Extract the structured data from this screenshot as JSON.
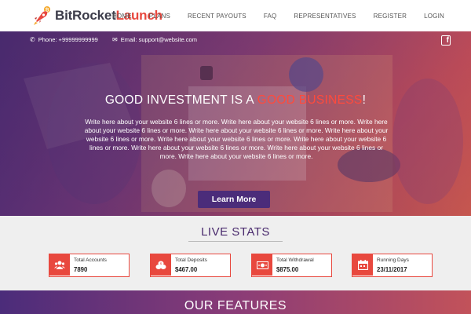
{
  "brand": {
    "name_part1": "BitRocket",
    "name_part2": "Launch",
    "accent": "#e8483e",
    "primary": "#4b2c7a"
  },
  "nav": {
    "items": [
      {
        "label": "HOME"
      },
      {
        "label": "PLANS"
      },
      {
        "label": "RECENT PAYOUTS"
      },
      {
        "label": "FAQ"
      },
      {
        "label": "REPRESENTATIVES"
      },
      {
        "label": "REGISTER"
      },
      {
        "label": "LOGIN"
      }
    ]
  },
  "topbar": {
    "phone": "Phone: +99999999999",
    "email": "Email: support@website.com",
    "social_icon": "facebook-icon"
  },
  "hero": {
    "headline_start": "GOOD INVESTMENT IS A ",
    "headline_highlight": "GOOD BUSINESS",
    "headline_end": "!",
    "description": "Write here about your website 6 lines or more. Write here about your website 6 lines or more. Write here about your website 6 lines or more. Write here about your website 6 lines or more. Write here about your website 6 lines or more. Write here about your website 6 lines or more. Write here about your website 6 lines or more. Write here about your website 6 lines or more. Write here about your website 6 lines or more. Write here about your website 6 lines or more.",
    "cta_label": "Learn More"
  },
  "stats": {
    "title": "LIVE STATS",
    "cards": [
      {
        "label": "Total Accounts",
        "value": "7890",
        "icon": "users-icon"
      },
      {
        "label": "Total Deposits",
        "value": "$467.00",
        "icon": "coins-icon"
      },
      {
        "label": "Total Withdrawal",
        "value": "$875.00",
        "icon": "money-icon"
      },
      {
        "label": "Running Days",
        "value": "23/11/2017",
        "icon": "calendar-icon"
      }
    ]
  },
  "features": {
    "title": "OUR FEATURES"
  }
}
